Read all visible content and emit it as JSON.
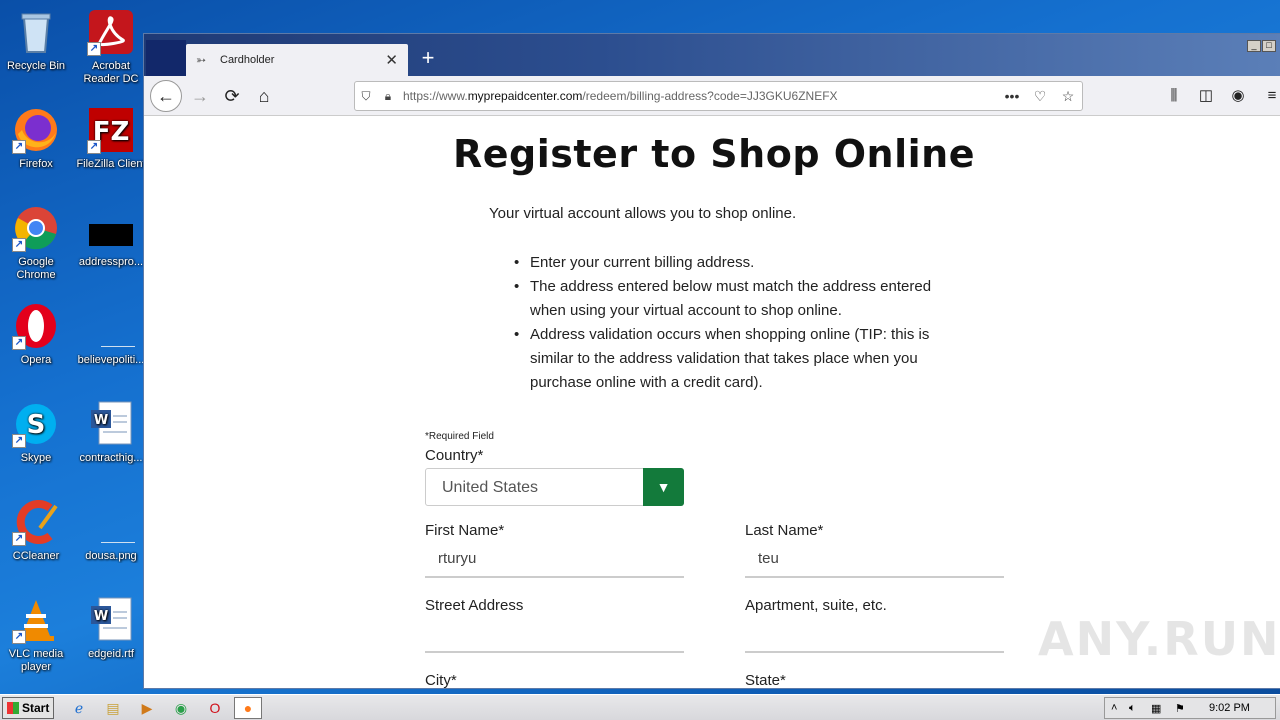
{
  "desktop": {
    "icons": [
      {
        "label": "Recycle Bin",
        "icon": "recycle-bin-icon"
      },
      {
        "label": "Acrobat Reader DC",
        "icon": "acrobat-icon"
      },
      {
        "label": "Firefox",
        "icon": "firefox-icon"
      },
      {
        "label": "FileZilla Client",
        "icon": "filezilla-icon"
      },
      {
        "label": "Google Chrome",
        "icon": "chrome-icon"
      },
      {
        "label": "addresspro...",
        "icon": "file-icon"
      },
      {
        "label": "Opera",
        "icon": "opera-icon"
      },
      {
        "label": "believepoliti...",
        "icon": "file-icon"
      },
      {
        "label": "Skype",
        "icon": "skype-icon"
      },
      {
        "label": "contracthig...",
        "icon": "word-doc-icon"
      },
      {
        "label": "CCleaner",
        "icon": "ccleaner-icon"
      },
      {
        "label": "dousa.png",
        "icon": "image-file-icon"
      },
      {
        "label": "VLC media player",
        "icon": "vlc-icon"
      },
      {
        "label": "edgeid.rtf",
        "icon": "word-doc-icon"
      }
    ]
  },
  "browser": {
    "tab_title": "Cardholder",
    "new_tab_symbol": "+",
    "url_prefix": "https://www.",
    "url_domain": "myprepaidcenter.com",
    "url_path": "/redeem/billing-address?code=JJ3GKU6ZNEFX",
    "page_actions": "•••"
  },
  "page": {
    "title": "Register to Shop Online",
    "intro": "Your virtual account allows you to shop online.",
    "bullets": [
      "Enter your current billing address.",
      "The address entered below must match the address entered when using your virtual account to shop online.",
      "Address validation occurs when shopping online (TIP: this is similar to the address validation that takes place when you purchase online with a credit card)."
    ],
    "required_note": "*Required Field",
    "country_label": "Country*",
    "country_value": "United States",
    "first_name_label": "First Name*",
    "first_name_value": "rturyu",
    "last_name_label": "Last Name*",
    "last_name_value": "teu",
    "street_label": "Street Address",
    "street_value": "",
    "apt_label": "Apartment, suite, etc.",
    "apt_value": "",
    "city_label": "City*",
    "state_label": "State*"
  },
  "watermark": "ANY.RUN",
  "taskbar": {
    "start_label": "Start",
    "clock": "9:02 PM"
  },
  "colors": {
    "select_button": "#137a3b",
    "desktop_blue": "#1570cf"
  }
}
